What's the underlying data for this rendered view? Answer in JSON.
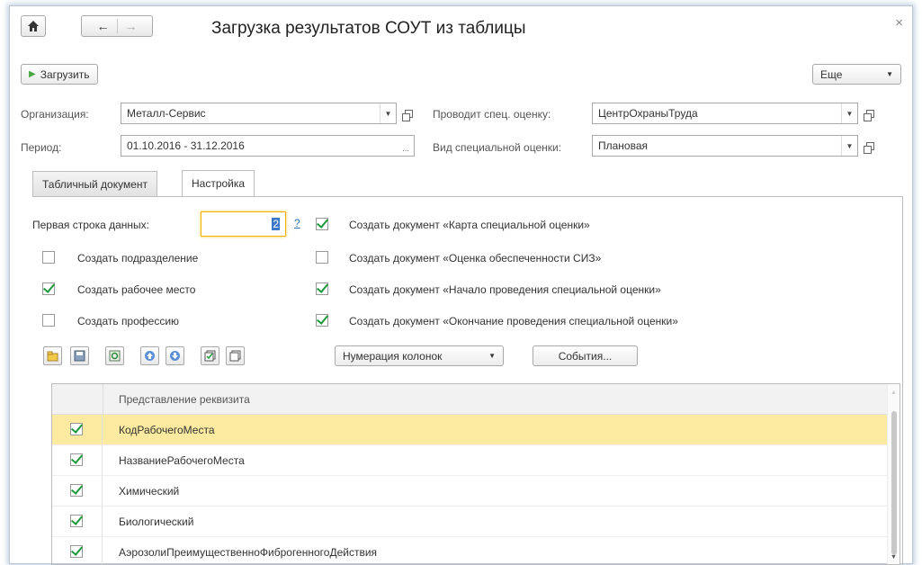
{
  "window": {
    "title": "Загрузка результатов СОУТ из таблицы",
    "close": "×"
  },
  "toolbar": {
    "load_label": "Загрузить",
    "more_label": "Еще"
  },
  "form": {
    "org_label": "Организация:",
    "org_value": "Металл-Сервис",
    "assessor_label": "Проводит спец. оценку:",
    "assessor_value": "ЦентрОхраныТруда",
    "period_label": "Период:",
    "period_value": "01.10.2016 - 31.12.2016",
    "type_label": "Вид специальной оценки:",
    "type_value": "Плановая"
  },
  "tabs": [
    {
      "label": "Табличный документ",
      "active": false
    },
    {
      "label": "Настройка",
      "active": true
    }
  ],
  "settings": {
    "first_row_label": "Первая строка данных:",
    "first_row_value": "2",
    "help": "?",
    "options_left": [
      {
        "label": "Создать подразделение",
        "checked": false
      },
      {
        "label": "Создать рабочее место",
        "checked": true
      },
      {
        "label": "Создать профессию",
        "checked": false
      }
    ],
    "options_right": [
      {
        "label": "Создать документ «Карта специальной оценки»",
        "checked": true
      },
      {
        "label": "Создать документ «Оценка обеспеченности СИЗ»",
        "checked": false
      },
      {
        "label": "Создать документ «Начало проведения специальной оценки»",
        "checked": true
      },
      {
        "label": "Создать документ «Окончание проведения специальной оценки»",
        "checked": true
      }
    ]
  },
  "table_toolbar": {
    "numbering_label": "Нумерация колонок",
    "events_label": "События..."
  },
  "table": {
    "header": "Представление реквизита",
    "rows": [
      {
        "label": "КодРабочегоМеста",
        "checked": true,
        "selected": true
      },
      {
        "label": "НазваниеРабочегоМеста",
        "checked": true,
        "selected": false
      },
      {
        "label": "Химический",
        "checked": true,
        "selected": false
      },
      {
        "label": "Биологический",
        "checked": true,
        "selected": false
      },
      {
        "label": "АэрозолиПреимущественноФиброгенногоДействия",
        "checked": true,
        "selected": false
      }
    ]
  }
}
